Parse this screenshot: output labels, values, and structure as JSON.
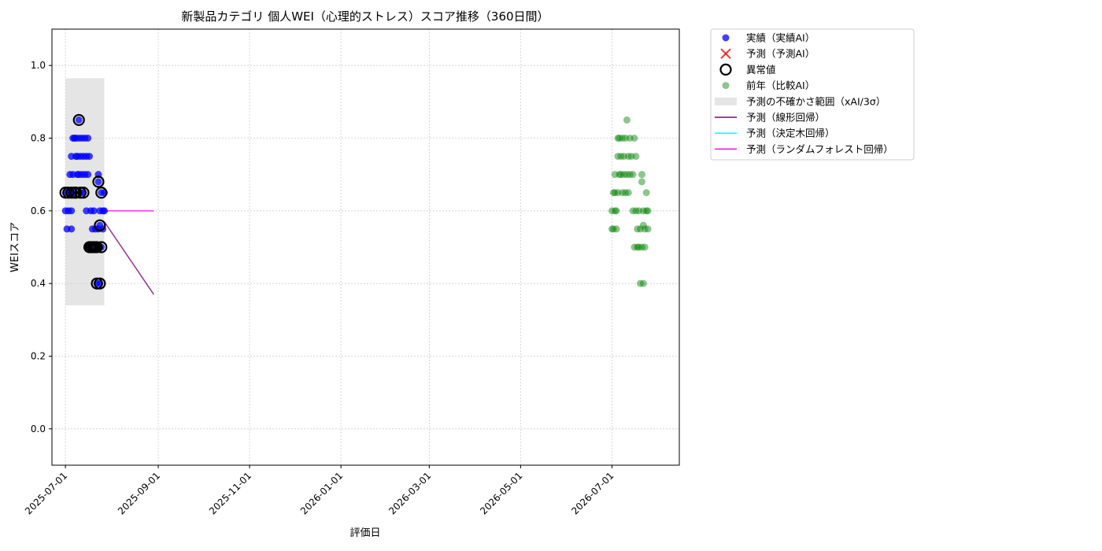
{
  "chart_data": {
    "type": "scatter",
    "title": "新製品カテゴリ 個人WEI（心理的ストレス）スコア推移（360日間）",
    "xlabel": "評価日",
    "ylabel": "WEIスコア",
    "xlim": [
      "2025-06-22",
      "2026-08-15"
    ],
    "ylim": [
      -0.1,
      1.1
    ],
    "y_ticks": [
      "0.0",
      "0.2",
      "0.4",
      "0.6",
      "0.8",
      "1.0"
    ],
    "x_ticks": [
      "2025-07-01",
      "2025-09-01",
      "2025-11-01",
      "2026-01-01",
      "2026-03-01",
      "2026-05-01",
      "2026-07-01"
    ],
    "grid": true,
    "legend_position": "outside right",
    "legend": [
      {
        "key": "actual",
        "label": "実績（実績AI）",
        "marker": "dot",
        "color": "#0000ff"
      },
      {
        "key": "predicted",
        "label": "予測（予測AI）",
        "marker": "x",
        "color": "#ff0000"
      },
      {
        "key": "anomaly",
        "label": "異常値",
        "marker": "ring",
        "color": "#000000"
      },
      {
        "key": "prev_year",
        "label": "前年（比較AI）",
        "marker": "dot",
        "color": "#008000"
      },
      {
        "key": "uncertainty",
        "label": "予測の不確かさ範囲（xAI/3σ）",
        "marker": "patch",
        "color": "#d3d3d3"
      },
      {
        "key": "linear",
        "label": "予測（線形回帰）",
        "marker": "line",
        "color": "#800080"
      },
      {
        "key": "tree",
        "label": "予測（決定木回帰）",
        "marker": "line",
        "color": "#00ffff"
      },
      {
        "key": "forest",
        "label": "予測（ランダムフォレスト回帰）",
        "marker": "line",
        "color": "#ff00ff"
      }
    ],
    "uncertainty_band": {
      "x": [
        "2025-07-01",
        "2025-07-27"
      ],
      "y": [
        0.34,
        0.965
      ]
    },
    "series": {
      "actual": [
        [
          "2025-07-01",
          0.65
        ],
        [
          "2025-07-01",
          0.6
        ],
        [
          "2025-07-02",
          0.55
        ],
        [
          "2025-07-03",
          0.65
        ],
        [
          "2025-07-03",
          0.6
        ],
        [
          "2025-07-04",
          0.7
        ],
        [
          "2025-07-04",
          0.65
        ],
        [
          "2025-07-05",
          0.6
        ],
        [
          "2025-07-05",
          0.55
        ],
        [
          "2025-07-05",
          0.75
        ],
        [
          "2025-07-06",
          0.8
        ],
        [
          "2025-07-06",
          0.7
        ],
        [
          "2025-07-07",
          0.8
        ],
        [
          "2025-07-07",
          0.65
        ],
        [
          "2025-07-08",
          0.75
        ],
        [
          "2025-07-08",
          0.8
        ],
        [
          "2025-07-09",
          0.7
        ],
        [
          "2025-07-09",
          0.75
        ],
        [
          "2025-07-10",
          0.85
        ],
        [
          "2025-07-10",
          0.8
        ],
        [
          "2025-07-10",
          0.7
        ],
        [
          "2025-07-11",
          0.65
        ],
        [
          "2025-07-11",
          0.75
        ],
        [
          "2025-07-12",
          0.7
        ],
        [
          "2025-07-12",
          0.8
        ],
        [
          "2025-07-13",
          0.75
        ],
        [
          "2025-07-13",
          0.65
        ],
        [
          "2025-07-14",
          0.8
        ],
        [
          "2025-07-14",
          0.7
        ],
        [
          "2025-07-15",
          0.75
        ],
        [
          "2025-07-15",
          0.6
        ],
        [
          "2025-07-16",
          0.8
        ],
        [
          "2025-07-16",
          0.7
        ],
        [
          "2025-07-17",
          0.75
        ],
        [
          "2025-07-17",
          0.5
        ],
        [
          "2025-07-18",
          0.6
        ],
        [
          "2025-07-18",
          0.5
        ],
        [
          "2025-07-19",
          0.55
        ],
        [
          "2025-07-20",
          0.5
        ],
        [
          "2025-07-20",
          0.6
        ],
        [
          "2025-07-21",
          0.55
        ],
        [
          "2025-07-22",
          0.5
        ],
        [
          "2025-07-22",
          0.4
        ],
        [
          "2025-07-23",
          0.7
        ],
        [
          "2025-07-23",
          0.55
        ],
        [
          "2025-07-23",
          0.68
        ],
        [
          "2025-07-24",
          0.56
        ],
        [
          "2025-07-24",
          0.6
        ],
        [
          "2025-07-24",
          0.4
        ],
        [
          "2025-07-25",
          0.5
        ],
        [
          "2025-07-25",
          0.65
        ],
        [
          "2025-07-26",
          0.6
        ],
        [
          "2025-07-26",
          0.55
        ],
        [
          "2025-07-27",
          0.65
        ],
        [
          "2025-07-27",
          0.6
        ]
      ],
      "anomaly": [
        [
          "2025-07-01",
          0.65
        ],
        [
          "2025-07-03",
          0.65
        ],
        [
          "2025-07-05",
          0.65
        ],
        [
          "2025-07-07",
          0.65
        ],
        [
          "2025-07-08",
          0.65
        ],
        [
          "2025-07-10",
          0.85
        ],
        [
          "2025-07-11",
          0.65
        ],
        [
          "2025-07-13",
          0.65
        ],
        [
          "2025-07-17",
          0.5
        ],
        [
          "2025-07-18",
          0.5
        ],
        [
          "2025-07-19",
          0.5
        ],
        [
          "2025-07-20",
          0.5
        ],
        [
          "2025-07-21",
          0.5
        ],
        [
          "2025-07-22",
          0.5
        ],
        [
          "2025-07-22",
          0.4
        ],
        [
          "2025-07-23",
          0.68
        ],
        [
          "2025-07-24",
          0.56
        ],
        [
          "2025-07-24",
          0.4
        ],
        [
          "2025-07-25",
          0.5
        ],
        [
          "2025-07-25",
          0.65
        ]
      ],
      "prev_year": [
        [
          "2026-07-01",
          0.6
        ],
        [
          "2026-07-01",
          0.55
        ],
        [
          "2026-07-02",
          0.65
        ],
        [
          "2026-07-02",
          0.55
        ],
        [
          "2026-07-03",
          0.6
        ],
        [
          "2026-07-03",
          0.65
        ],
        [
          "2026-07-03",
          0.7
        ],
        [
          "2026-07-04",
          0.6
        ],
        [
          "2026-07-04",
          0.55
        ],
        [
          "2026-07-05",
          0.8
        ],
        [
          "2026-07-05",
          0.75
        ],
        [
          "2026-07-05",
          0.65
        ],
        [
          "2026-07-06",
          0.7
        ],
        [
          "2026-07-06",
          0.8
        ],
        [
          "2026-07-07",
          0.75
        ],
        [
          "2026-07-07",
          0.7
        ],
        [
          "2026-07-08",
          0.8
        ],
        [
          "2026-07-08",
          0.65
        ],
        [
          "2026-07-09",
          0.75
        ],
        [
          "2026-07-09",
          0.7
        ],
        [
          "2026-07-10",
          0.8
        ],
        [
          "2026-07-10",
          0.65
        ],
        [
          "2026-07-11",
          0.85
        ],
        [
          "2026-07-11",
          0.7
        ],
        [
          "2026-07-12",
          0.75
        ],
        [
          "2026-07-12",
          0.65
        ],
        [
          "2026-07-13",
          0.7
        ],
        [
          "2026-07-13",
          0.8
        ],
        [
          "2026-07-14",
          0.75
        ],
        [
          "2026-07-15",
          0.6
        ],
        [
          "2026-07-15",
          0.7
        ],
        [
          "2026-07-16",
          0.8
        ],
        [
          "2026-07-16",
          0.5
        ],
        [
          "2026-07-17",
          0.75
        ],
        [
          "2026-07-17",
          0.6
        ],
        [
          "2026-07-18",
          0.5
        ],
        [
          "2026-07-18",
          0.55
        ],
        [
          "2026-07-19",
          0.6
        ],
        [
          "2026-07-19",
          0.5
        ],
        [
          "2026-07-20",
          0.55
        ],
        [
          "2026-07-20",
          0.4
        ],
        [
          "2026-07-21",
          0.7
        ],
        [
          "2026-07-21",
          0.5
        ],
        [
          "2026-07-21",
          0.68
        ],
        [
          "2026-07-22",
          0.56
        ],
        [
          "2026-07-22",
          0.6
        ],
        [
          "2026-07-22",
          0.4
        ],
        [
          "2026-07-23",
          0.5
        ],
        [
          "2026-07-23",
          0.55
        ],
        [
          "2026-07-24",
          0.65
        ],
        [
          "2026-07-24",
          0.6
        ],
        [
          "2026-07-25",
          0.55
        ],
        [
          "2026-07-25",
          0.6
        ]
      ],
      "linear": [
        [
          "2025-07-27",
          0.57
        ],
        [
          "2025-08-29",
          0.37
        ]
      ],
      "forest": [
        [
          "2025-07-27",
          0.6
        ],
        [
          "2025-08-29",
          0.6
        ]
      ]
    }
  }
}
